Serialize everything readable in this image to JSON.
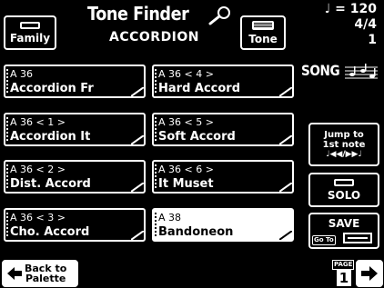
{
  "header": {
    "title": "Tone Finder",
    "category": "ACCORDION",
    "family_label": "Family",
    "tone_label": "Tone"
  },
  "status": {
    "tempo": "♩ = 120",
    "time_signature": "4/4",
    "measure": "1",
    "song_label": "SONG"
  },
  "tones": [
    {
      "code": "A 36",
      "name": "Accordion Fr",
      "selected": false
    },
    {
      "code": "A 36 < 4 >",
      "name": "Hard Accord",
      "selected": false
    },
    {
      "code": "A 36 < 1 >",
      "name": "Accordion It",
      "selected": false
    },
    {
      "code": "A 36 < 5 >",
      "name": "Soft Accord",
      "selected": false
    },
    {
      "code": "A 36 < 2 >",
      "name": "Dist. Accord",
      "selected": false
    },
    {
      "code": "A 36 < 6 >",
      "name": "It Muset",
      "selected": false
    },
    {
      "code": "A 36 < 3 >",
      "name": "Cho. Accord",
      "selected": false
    },
    {
      "code": "A 38",
      "name": "Bandoneon",
      "selected": true
    }
  ],
  "side_buttons": {
    "jump_line1": "Jump to",
    "jump_line2": "1st note",
    "jump_symbols": "♩◀◀/▶▶♩",
    "solo": "SOLO",
    "save": "SAVE",
    "goto": "Go To"
  },
  "footer": {
    "back_line1": "Back to",
    "back_line2": "Palette",
    "page_label": "PAGE",
    "page_number": "1"
  }
}
